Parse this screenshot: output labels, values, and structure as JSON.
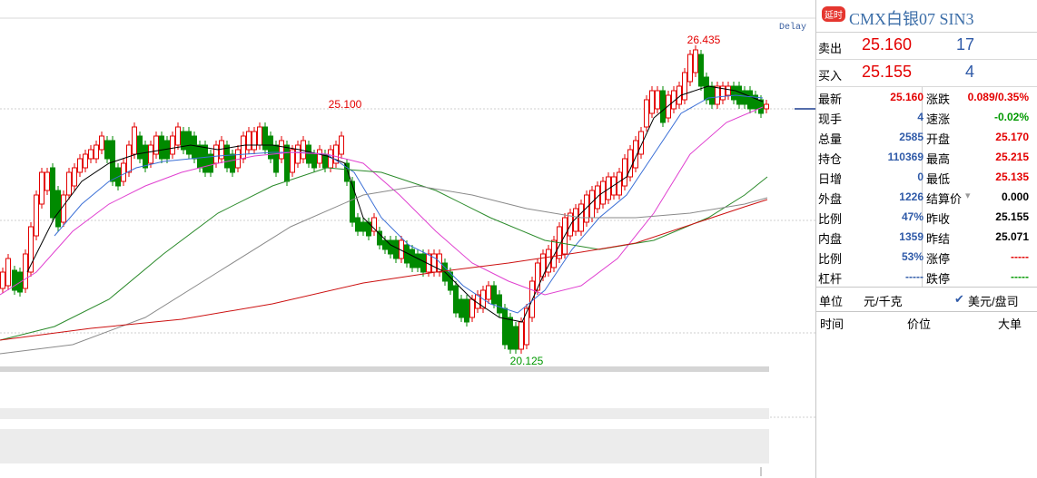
{
  "chart": {
    "delay_label": "Delay",
    "annotations": {
      "high": "26.435",
      "mid_high": "25.100",
      "low": "20.125"
    }
  },
  "header": {
    "badge": "延时",
    "title": "CMX白银07 SIN3"
  },
  "order_book": {
    "sell": {
      "label": "卖出",
      "price": "25.160",
      "volume": "17"
    },
    "buy": {
      "label": "买入",
      "price": "25.155",
      "volume": "4"
    }
  },
  "stats": [
    {
      "k1": "最新",
      "v1": "25.160",
      "c1": "red",
      "k2": "涨跌",
      "v2": "0.089/0.35%",
      "c2": "red"
    },
    {
      "k1": "现手",
      "v1": "4",
      "c1": "blue",
      "k2": "速涨",
      "v2": "-0.02%",
      "c2": "green"
    },
    {
      "k1": "总量",
      "v1": "2585",
      "c1": "blue",
      "k2": "开盘",
      "v2": "25.170",
      "c2": "red"
    },
    {
      "k1": "持仓",
      "v1": "110369",
      "c1": "blue",
      "k2": "最高",
      "v2": "25.215",
      "c2": "red"
    },
    {
      "k1": "日增",
      "v1": "0",
      "c1": "blue",
      "k2": "最低",
      "v2": "25.135",
      "c2": "red"
    },
    {
      "k1": "外盘",
      "v1": "1226",
      "c1": "blue",
      "k2": "结算价",
      "v2": "0.000",
      "c2": "black"
    },
    {
      "k1": "比例",
      "v1": "47%",
      "c1": "blue",
      "k2": "昨收",
      "v2": "25.155",
      "c2": "black"
    },
    {
      "k1": "内盘",
      "v1": "1359",
      "c1": "blue",
      "k2": "昨结",
      "v2": "25.071",
      "c2": "black"
    },
    {
      "k1": "比例",
      "v1": "53%",
      "c1": "blue",
      "k2": "涨停",
      "v2": "-----",
      "c2": "red"
    },
    {
      "k1": "杠杆",
      "v1": "-----",
      "c1": "blue",
      "k2": "跌停",
      "v2": "-----",
      "c2": "green"
    }
  ],
  "unit": {
    "label": "单位",
    "value": "元/千克",
    "option": "美元/盘司"
  },
  "trades": {
    "time": "时间",
    "price": "价位",
    "size": "大单"
  },
  "colors": {
    "up": "#e30000",
    "down": "#008a00",
    "ma5": "#000000",
    "ma10": "#3b6fd6",
    "ma20": "#e040d0",
    "ma60": "#2a8a2a",
    "ma120": "#8a8a8a",
    "ma250": "#cc1111"
  }
}
